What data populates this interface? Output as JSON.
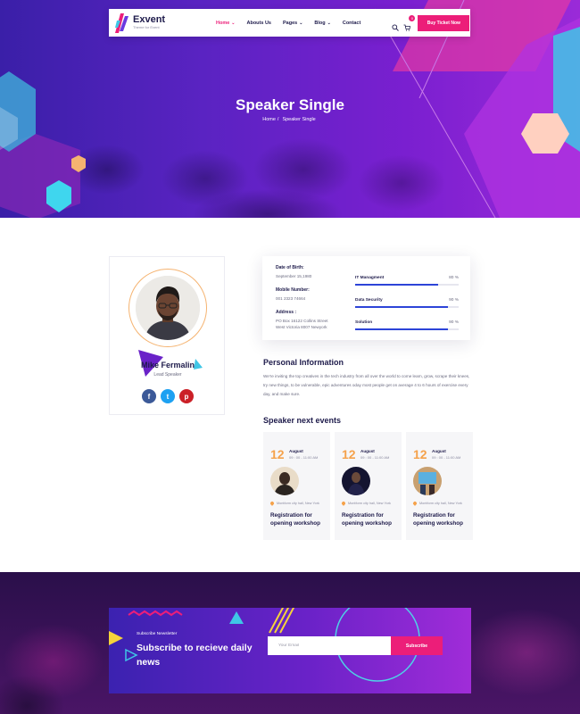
{
  "brand": {
    "name": "Exvent",
    "tagline": "Theme for Event"
  },
  "nav": {
    "items": [
      {
        "label": "Home",
        "active": true,
        "dropdown": true
      },
      {
        "label": "Abouts Us",
        "active": false,
        "dropdown": false
      },
      {
        "label": "Pages",
        "active": false,
        "dropdown": true
      },
      {
        "label": "Blog",
        "active": false,
        "dropdown": true
      },
      {
        "label": "Contact",
        "active": false,
        "dropdown": false
      }
    ],
    "caret": "⌄",
    "cart_count": "0",
    "cta": "Buy Ticket Now"
  },
  "hero": {
    "title": "Speaker Single",
    "breadcrumb": {
      "home": "Home",
      "separator": "/",
      "current": "Speaker Single"
    }
  },
  "speaker": {
    "name": "Mike Fermalin",
    "role": "Lead Speaker",
    "socials": [
      {
        "icon": "facebook-icon",
        "glyph": "f",
        "color": "#3b5998"
      },
      {
        "icon": "twitter-icon",
        "glyph": "t",
        "color": "#1da1f2"
      },
      {
        "icon": "pinterest-icon",
        "glyph": "p",
        "color": "#cb2027"
      }
    ]
  },
  "details": {
    "dob_label": "Date of Birth:",
    "dob_value": "September 15,1980",
    "mobile_label": "Mobile Number:",
    "mobile_value": "001 2323 74664",
    "address_label": "Address :",
    "address_line1": "PO Box 16122 Collins Street",
    "address_line2": "West Victoria 8007 Newyork"
  },
  "skills": [
    {
      "name": "IT Managment",
      "percent": 80,
      "label": "80 %"
    },
    {
      "name": "Data Security",
      "percent": 90,
      "label": "90 %"
    },
    {
      "name": "Solution",
      "percent": 90,
      "label": "90 %"
    }
  ],
  "personal": {
    "title": "Personal Information",
    "text": "We're inviting the top creatives in the tech industry from all over the world to come learn, grow, scrape their knees, try new things, to be vulnerable, epic adventures oday most people get on average 4 to 6 hours of exercise every day, and make sure."
  },
  "events": {
    "title": "Speaker next events",
    "items": [
      {
        "day": "12",
        "month": "August",
        "time": "09 : 00 - 11:00 AM",
        "location": "Montform city hall, New York",
        "title": "Registration for opening workshop"
      },
      {
        "day": "12",
        "month": "August",
        "time": "09 : 00 - 11:00 AM",
        "location": "Montform city hall, New York",
        "title": "Registration for opening workshop"
      },
      {
        "day": "12",
        "month": "August",
        "time": "09 : 00 - 11:00 AM",
        "location": "Montform city hall, New York",
        "title": "Registration for opening workshop"
      }
    ]
  },
  "newsletter": {
    "label": "Subscribe Newsletter",
    "title": "Subscribe to recieve daily news",
    "placeholder": "Your Email",
    "button": "Subscribe"
  },
  "colors": {
    "accent": "#ec1e79",
    "orange": "#f5a24b",
    "navy": "#1e1b4b",
    "skill_bar": "#2d44d8",
    "cyan": "#4fd1e6",
    "purple": "#7a1fd0"
  }
}
